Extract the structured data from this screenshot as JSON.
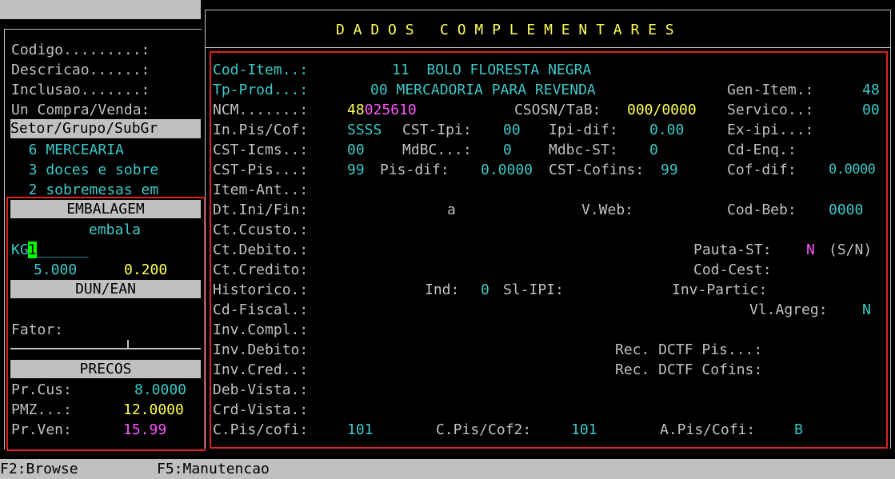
{
  "left": {
    "codigo": "Codigo.........:",
    "descricao": "Descricao......:",
    "inclusao": "Inclusao.......:",
    "un_compra": "Un Compra/Venda:",
    "setor_header": "Setor/Grupo/SubGr",
    "setor": "  6 MERCEARIA",
    "grupo": "  3 doces e sobre",
    "subgrupo": "  2 sobremesas em",
    "embalagem_title": "EMBALAGEM",
    "emb_qty": "1",
    "emb_underline": "______",
    "emb_desc": "embala",
    "unit": "KG",
    "emb_val1": "5.000",
    "emb_val2": "0.200",
    "dun_title": "DUN/EAN",
    "fator_label": "Fator:",
    "precos_title": "PRECOS",
    "prcus_label": "Pr.Cus:",
    "prcus_value": "8.0000",
    "pmz_label": "PMZ...:",
    "pmz_value": "12.0000",
    "prven_label": "Pr.Ven:",
    "prven_value": "15.99"
  },
  "dialog": {
    "title": "D A D O S   C O M P L E M E N T A R E S",
    "cod_item_label": "Cod-Item..:",
    "cod_item_value": "11  BOLO FLORESTA NEGRA",
    "tp_prod_label": "Tp-Prod...:",
    "tp_prod_value": "00 MERCADORIA PARA REVENDA",
    "gen_item_label": "Gen-Item.:",
    "gen_item_value": "48",
    "ncm_label": "NCM.......:",
    "ncm_value_a": "48",
    "ncm_value_b": "025610",
    "csosn_label": "CSOSN/TaB:",
    "csosn_value": "000/0000",
    "servico_label": "Servico..:",
    "servico_value": "00",
    "inpis_label": "In.Pis/Cof:",
    "inpis_value": "SSSS",
    "cstipi_label": "CST-Ipi:",
    "cstipi_value": "00",
    "ipidif_label": "Ipi-dif:",
    "ipidif_value": "0.00",
    "exipi_label": "Ex-ipi...:",
    "csticms_label": "CST-Icms..:",
    "csticms_value": "00",
    "mdbc_label": "MdBC...:",
    "mdbc_value": "0",
    "mdbcst_label": "Mdbc-ST:",
    "mdbcst_value": "0",
    "cdenq_label": "Cd-Enq.:",
    "cstpis_label": "CST-Pis...:",
    "cstpis_value": "99",
    "pisdif_label": "Pis-dif:",
    "pisdif_value": "0.0000",
    "cstcofins_label": "CST-Cofins:",
    "cstcofins_value": "99",
    "cofdif_label": "Cof-dif:",
    "cofdif_value": "0.0000",
    "itemant_label": "Item-Ant..:",
    "dtini_label": "Dt.Ini/Fin:",
    "dtini_value": "a",
    "vweb_label": "V.Web:",
    "codbeb_label": "Cod-Beb:",
    "codbeb_value": "0000",
    "ctccusto_label": "Ct.Ccusto.:",
    "ctdebito_label": "Ct.Debito.:",
    "pautast_label": "Pauta-ST:",
    "pautast_value": "N",
    "pautast_hint": "(S/N)",
    "ctcredito_label": "Ct.Credito:",
    "codcest_label": "Cod-Cest:",
    "historico_label": "Historico.:",
    "ind_label": "Ind:",
    "ind_value": "0",
    "slipi_label": "Sl-IPI:",
    "invpartic_label": "Inv-Partic:",
    "cdfiscal_label": "Cd-Fiscal.:",
    "vlagreg_label": "Vl.Agreg:",
    "vlagreg_value": "N",
    "invcompl_label": "Inv.Compl.:",
    "invdebito_label": "Inv.Debito:",
    "recdctfpis_label": "Rec. DCTF Pis...:",
    "invcred_label": "Inv.Cred..:",
    "recdctfcof_label": "Rec. DCTF Cofins:",
    "debvista_label": "Deb-Vista.:",
    "crdvista_label": "Crd-Vista.:",
    "cpiscofi_label": "C.Pis/cofi:",
    "cpiscofi_value": "101",
    "cpiscof2_label": "C.Pis/Cof2:",
    "cpiscof2_value": "101",
    "apiscofi_label": "A.Pis/Cofi:",
    "apiscofi_value": "B"
  },
  "statusbar": {
    "f2": "F2:Browse",
    "f5": "F5:Manutencao"
  },
  "colors": {
    "background": "#000000",
    "label": "#c0c0c0",
    "cyan": "#3cc8c8",
    "yellow": "#ffff55",
    "magenta": "#ff55ff",
    "cursor": "#00ff00",
    "highlight_box": "#e02020"
  }
}
